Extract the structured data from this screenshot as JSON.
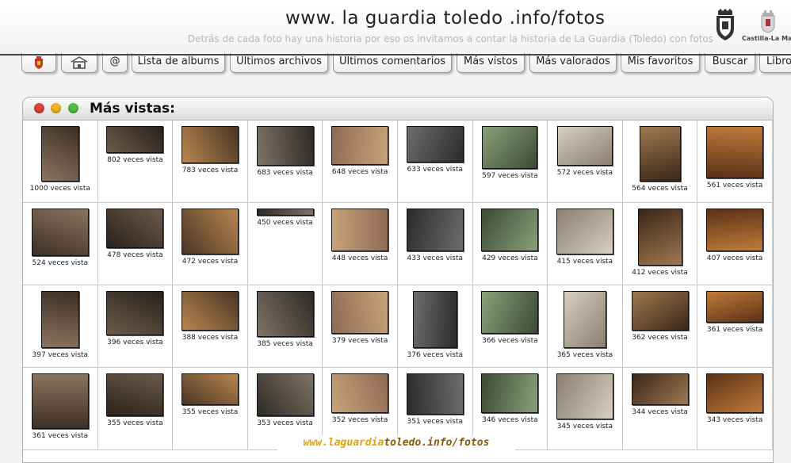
{
  "site": {
    "title": "www. la guardia toledo .info/fotos",
    "subtitle": "Detrás de cada foto hay una historia por eso os invitamos a contar la historia de La Guardia (Toledo) con fotos",
    "region_label": "Castilla-La Mancha"
  },
  "colors": {
    "light_red": "#e0413a",
    "light_yellow": "#f0b323",
    "light_green": "#4cbf3b",
    "footer_orange": "#e8a200",
    "footer_dark": "#8a5a00"
  },
  "tabs": [
    {
      "label": "",
      "icon": "crest-icon"
    },
    {
      "label": "",
      "icon": "home-icon"
    },
    {
      "label": "@"
    },
    {
      "label": "Lista de albums"
    },
    {
      "label": "Últimos archivos"
    },
    {
      "label": "Últimos comentarios"
    },
    {
      "label": "Más vistos"
    },
    {
      "label": "Más valorados"
    },
    {
      "label": "Mis favoritos"
    },
    {
      "label": "Buscar"
    },
    {
      "label": "Libro"
    }
  ],
  "panel": {
    "title": "Más vistas:"
  },
  "photos": [
    "1000 veces vista",
    "802 veces vista",
    "783 veces vista",
    "683 veces vista",
    "648 veces vista",
    "633 veces vista",
    "597 veces vista",
    "572 veces vista",
    "564 veces vista",
    "561 veces vista",
    "524 veces vista",
    "478 veces vista",
    "472 veces vista",
    "450 veces vista",
    "448 veces vista",
    "433 veces vista",
    "429 veces vista",
    "415 veces vista",
    "412 veces vista",
    "407 veces vista",
    "397 veces vista",
    "396 veces vista",
    "388 veces vista",
    "385 veces vista",
    "379 veces vista",
    "376 veces vista",
    "366 veces vista",
    "365 veces vista",
    "362 veces vista",
    "361 veces vista",
    "361 veces vista",
    "355 veces vista",
    "355 veces vista",
    "353 veces vista",
    "352 veces vista",
    "351 veces vista",
    "346 veces vista",
    "345 veces vista",
    "344 veces vista",
    "343 veces vista"
  ],
  "footer": {
    "part1": "www.laguardia",
    "part2": "toledo.info/fotos"
  }
}
